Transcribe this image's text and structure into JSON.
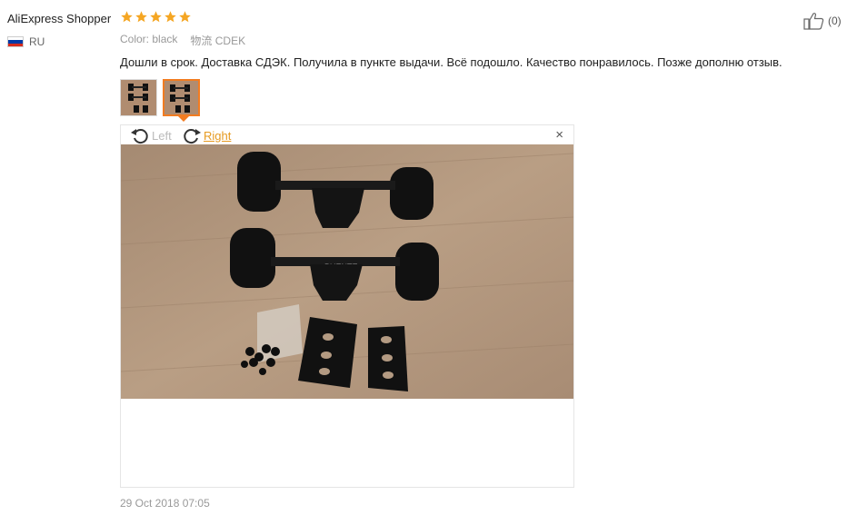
{
  "reviewer": {
    "name": "AliExpress Shopper",
    "rating": 5,
    "country": "RU"
  },
  "colors": {
    "star": "#f5a623",
    "accent": "#f27c21",
    "link": "#e69a1f",
    "flag": [
      "#ffffff",
      "#0039a6",
      "#d52b1e"
    ]
  },
  "like": {
    "count": "(0)",
    "icon": "thumbs-up-icon"
  },
  "properties": [
    {
      "key": "Color:",
      "value": "black"
    },
    {
      "key": "物流",
      "value": "CDEK"
    }
  ],
  "review_text": "Дошли в срок. Доставка СДЭК. Получила в пункте выдачи. Всё подошло. Качество понравилось. Позже дополню отзыв.",
  "viewer": {
    "rotate_left": "Left",
    "rotate_right": "Right",
    "close": "×"
  },
  "date": "29 Oct 2018 07:05"
}
